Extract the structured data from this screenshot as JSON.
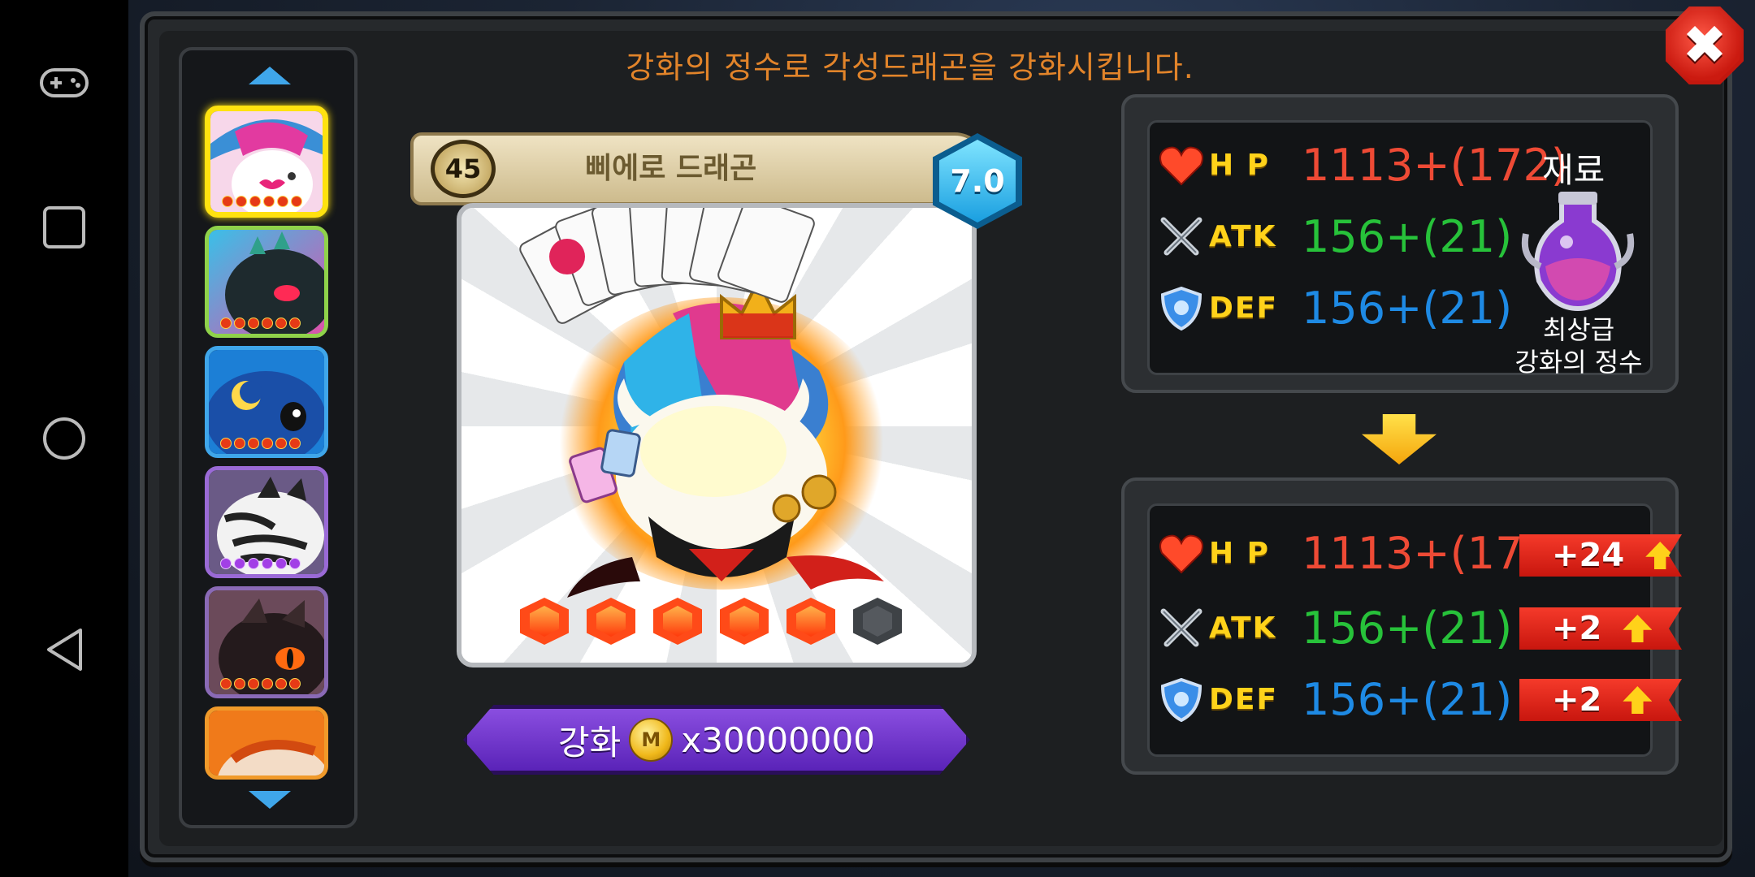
{
  "android_nav": {
    "icons": [
      "gamepad-icon",
      "recent-apps-icon",
      "home-icon",
      "back-icon"
    ]
  },
  "header": {
    "text": "강화의 정수로 각성드래곤을 강화시킵니다."
  },
  "dragon_list": {
    "slots": [
      {
        "name": "jester-dragon",
        "stars": 6,
        "star_color": "red",
        "selected": true
      },
      {
        "name": "dark-green-dragon",
        "stars": 6,
        "star_color": "red",
        "selected": false
      },
      {
        "name": "blue-moon-dragon",
        "stars": 6,
        "star_color": "red",
        "selected": false
      },
      {
        "name": "white-zebra-dragon",
        "stars": 6,
        "star_color": "purple",
        "selected": false
      },
      {
        "name": "black-fire-dragon",
        "stars": 6,
        "star_color": "red",
        "selected": false
      },
      {
        "name": "orange-dragon",
        "stars": 0,
        "star_color": "red",
        "selected": false
      }
    ]
  },
  "dragon_card": {
    "level": "45",
    "name": "삐에로 드래곤",
    "grade": "7.0",
    "gems_filled": 5,
    "gems_total": 6
  },
  "enhance_button": {
    "label": "강화",
    "coin_symbol": "M",
    "cost": "x30000000"
  },
  "current_stats": {
    "hp_label": "H P",
    "hp_value": "1113+(172)",
    "atk_label": "ATK",
    "atk_value": "156+(21)",
    "def_label": "DEF",
    "def_value": "156+(21)"
  },
  "material": {
    "label": "재료",
    "name_line1": "최상급",
    "name_line2": "강화의 정수"
  },
  "next_stats": {
    "hp_label": "H P",
    "hp_value": "1113+(172)",
    "hp_gain": "+24",
    "atk_label": "ATK",
    "atk_value": "156+(21)",
    "atk_gain": "+2",
    "def_label": "DEF",
    "def_value": "156+(21)",
    "def_gain": "+2"
  },
  "colors": {
    "header": "#e2842a",
    "hp": "#ee4a35",
    "atk": "#27c23a",
    "def": "#1e8ae4",
    "stat_label": "#ffd21a",
    "selected_border": "#ffe20f"
  }
}
